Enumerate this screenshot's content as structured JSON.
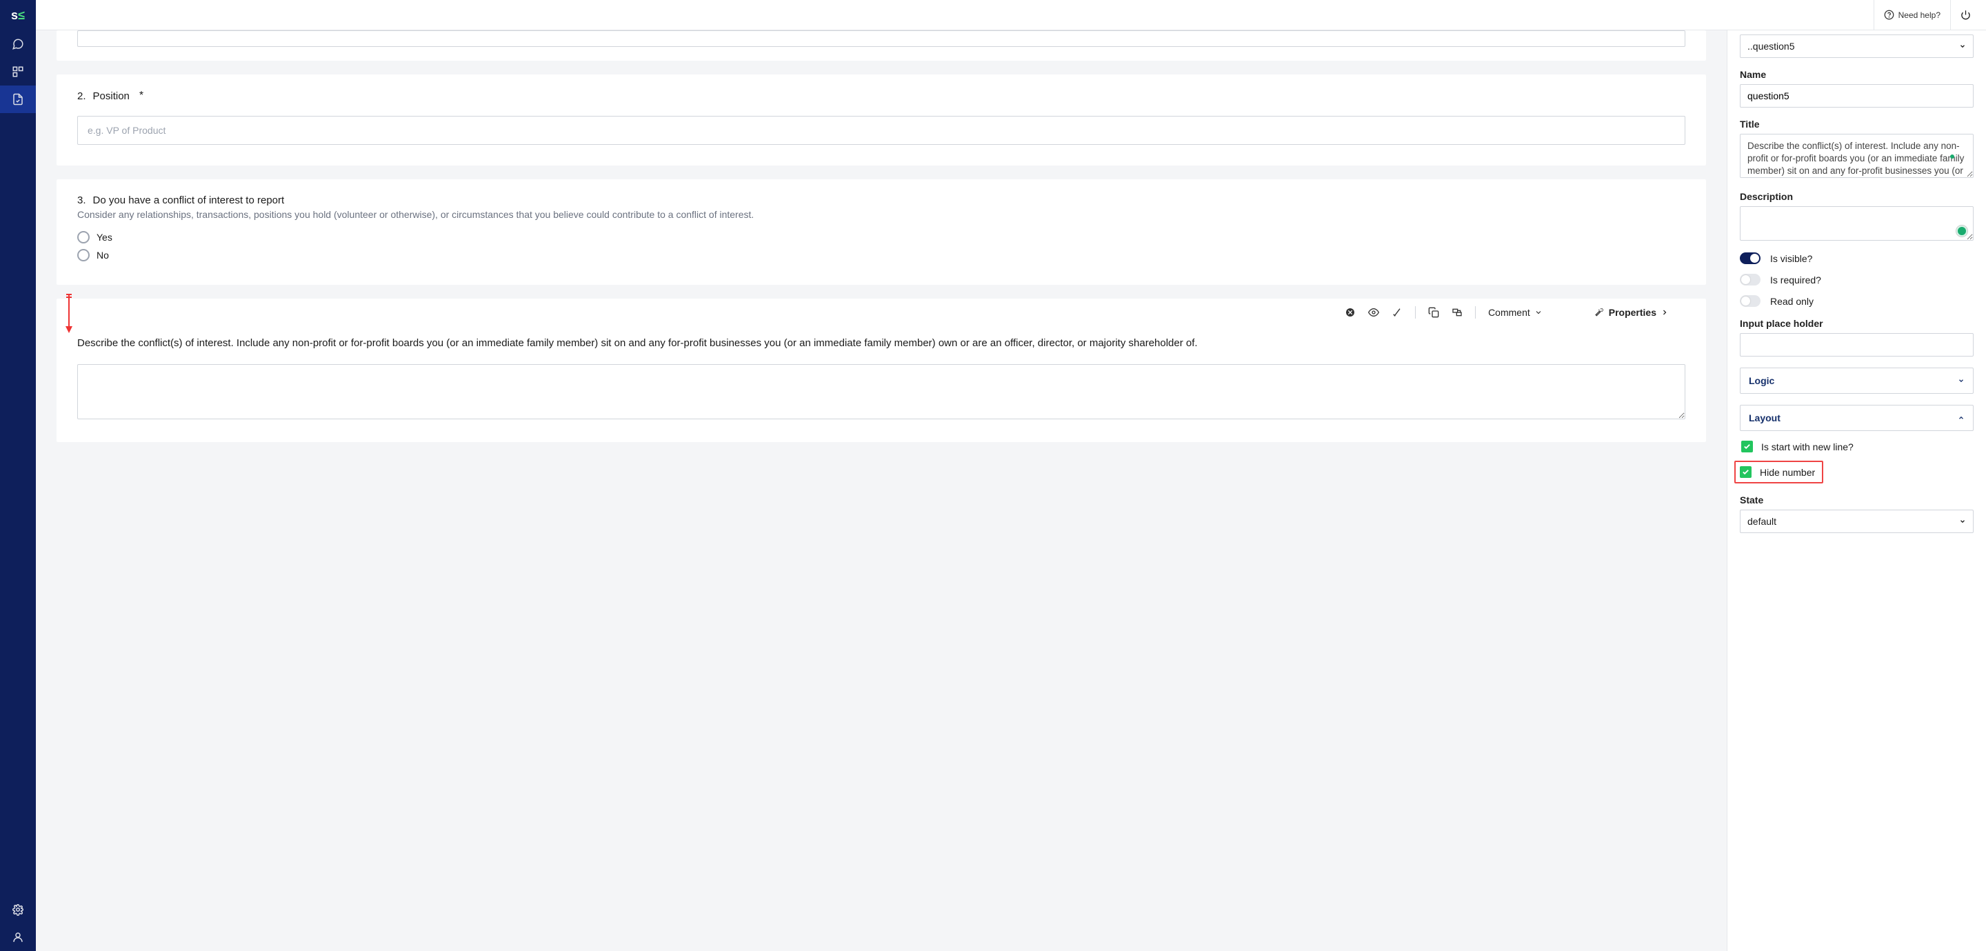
{
  "topbar": {
    "help_label": "Need help?"
  },
  "questions": {
    "q2": {
      "num": "2.",
      "title": "Position",
      "placeholder": "e.g. VP of Product"
    },
    "q3": {
      "num": "3.",
      "title": "Do you have a conflict of interest to report",
      "desc": "Consider any relationships, transactions, positions you hold (volunteer or otherwise), or circumstances that you believe could contribute to a conflict of interest.",
      "opt_yes": "Yes",
      "opt_no": "No"
    },
    "q5": {
      "text": "Describe the conflict(s) of interest. Include any non-profit or for-profit boards you (or an immediate family member) sit on and any for-profit businesses you (or an immediate family member) own or are an officer, director, or majority shareholder of."
    }
  },
  "toolbar": {
    "comment": "Comment",
    "properties": "Properties"
  },
  "panel": {
    "path": "..question5",
    "name_label": "Name",
    "name_value": "question5",
    "title_label": "Title",
    "title_value": "Describe the conflict(s) of interest. Include any non-profit or for-profit boards you (or an immediate family member) sit on and any for-profit businesses you (or an immediate family",
    "desc_label": "Description",
    "visible": "Is visible?",
    "required": "Is required?",
    "readonly": "Read only",
    "placeholder_label": "Input place holder",
    "logic": "Logic",
    "layout": "Layout",
    "start_new_line": "Is start with new line?",
    "hide_number": "Hide number",
    "state_label": "State",
    "state_value": "default"
  }
}
